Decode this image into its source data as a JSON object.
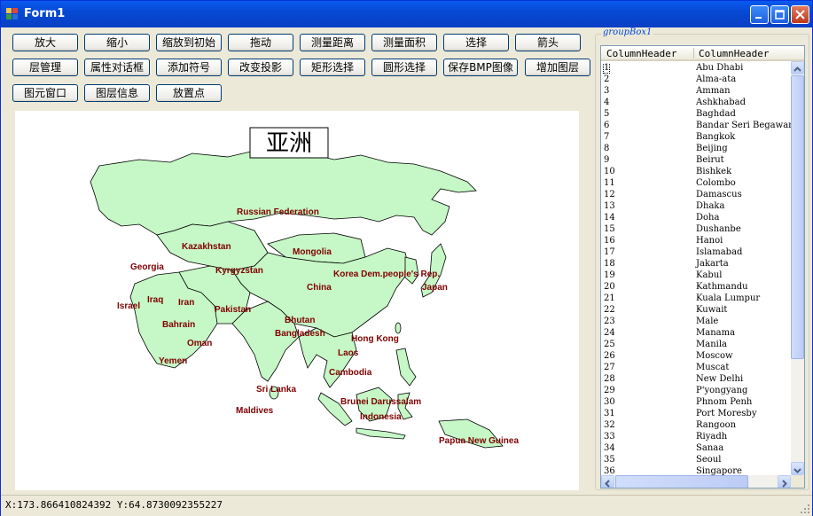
{
  "window": {
    "title": "Form1"
  },
  "toolbar": {
    "row1": [
      "放大",
      "缩小",
      "缩放到初始",
      "拖动",
      "测量距离",
      "测量面积",
      "选择",
      "箭头"
    ],
    "row2": [
      "层管理",
      "属性对话框",
      "添加符号",
      "改变投影",
      "矩形选择",
      "圆形选择",
      "保存BMP图像",
      "增加图层"
    ],
    "row3": [
      "图元窗口",
      "图层信息",
      "放置点"
    ]
  },
  "map": {
    "title": "亚洲",
    "countries": [
      "Russian Federation",
      "Kazakhstan",
      "Mongolia",
      "Georgia",
      "Kyrgyzstan",
      "Korea Dem.people's Rep.",
      "Japan",
      "China",
      "Iraq",
      "Iran",
      "Israel",
      "Pakistan",
      "Bahrain",
      "Bhutan",
      "Bangladesh",
      "Oman",
      "Hong Kong",
      "Yemen",
      "Laos",
      "Cambodia",
      "Sri Lanka",
      "Brunei Darussalam",
      "Maldives",
      "Indonesia",
      "Papua New Guinea"
    ],
    "land_color": "#c6f7c6",
    "label_color": "#800000"
  },
  "groupbox": {
    "label": "groupBox1"
  },
  "listview": {
    "headers": [
      "ColumnHeader",
      "ColumnHeader"
    ],
    "rows": [
      [
        "1",
        "Abu Dhabi"
      ],
      [
        "2",
        "Alma-ata"
      ],
      [
        "3",
        "Amman"
      ],
      [
        "4",
        "Ashkhabad"
      ],
      [
        "5",
        "Baghdad"
      ],
      [
        "6",
        "Bandar Seri Begawan"
      ],
      [
        "7",
        "Bangkok"
      ],
      [
        "8",
        "Beijing"
      ],
      [
        "9",
        "Beirut"
      ],
      [
        "10",
        "Bishkek"
      ],
      [
        "11",
        "Colombo"
      ],
      [
        "12",
        "Damascus"
      ],
      [
        "13",
        "Dhaka"
      ],
      [
        "14",
        "Doha"
      ],
      [
        "15",
        "Dushanbe"
      ],
      [
        "16",
        "Hanoi"
      ],
      [
        "17",
        "Islamabad"
      ],
      [
        "18",
        "Jakarta"
      ],
      [
        "19",
        "Kabul"
      ],
      [
        "20",
        "Kathmandu"
      ],
      [
        "21",
        "Kuala Lumpur"
      ],
      [
        "22",
        "Kuwait"
      ],
      [
        "23",
        "Male"
      ],
      [
        "24",
        "Manama"
      ],
      [
        "25",
        "Manila"
      ],
      [
        "26",
        "Moscow"
      ],
      [
        "27",
        "Muscat"
      ],
      [
        "28",
        "New Delhi"
      ],
      [
        "29",
        "P'yongyang"
      ],
      [
        "30",
        "Phnom Penh"
      ],
      [
        "31",
        "Port Moresby"
      ],
      [
        "32",
        "Rangoon"
      ],
      [
        "33",
        "Riyadh"
      ],
      [
        "34",
        "Sanaa"
      ],
      [
        "35",
        "Seoul"
      ],
      [
        "36",
        "Singapore"
      ]
    ]
  },
  "statusbar": {
    "text": "X:173.866410824392 Y:64.8730092355227"
  }
}
